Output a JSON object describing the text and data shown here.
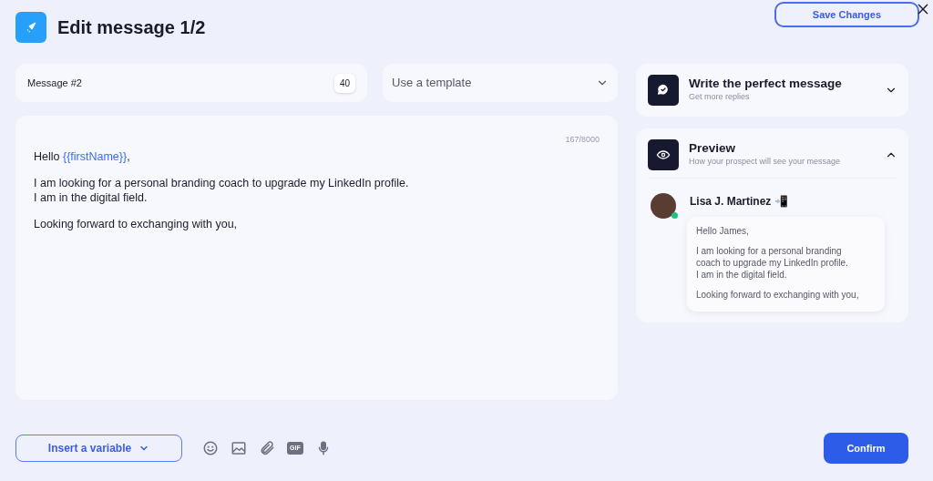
{
  "header": {
    "title": "Edit message 1/2",
    "save_button": "Save Changes"
  },
  "message_name": {
    "value": "Message #2",
    "count": "40"
  },
  "template_select": {
    "placeholder": "Use a template"
  },
  "editor": {
    "counter": "167/8000",
    "paragraphs": [
      [
        {
          "kind": "text",
          "text": "Hello "
        },
        {
          "kind": "variable",
          "text": "{{firstName}}"
        },
        {
          "kind": "text",
          "text": ","
        }
      ],
      [
        {
          "kind": "text",
          "text": "I am looking for a personal branding coach to upgrade my LinkedIn profile.\nI am in the digital field."
        }
      ],
      [
        {
          "kind": "text",
          "text": "Looking forward to exchanging with you,"
        }
      ]
    ]
  },
  "toolbar": {
    "variable_button": "Insert a variable",
    "tools": [
      {
        "kind": "emoji"
      },
      {
        "kind": "image"
      },
      {
        "kind": "attachment"
      },
      {
        "kind": "gif",
        "label": "GIF"
      },
      {
        "kind": "microphone"
      }
    ],
    "confirm_button": "Confirm"
  },
  "panels": [
    {
      "kind": "tips",
      "title": "Write the perfect message",
      "subtitle": "Get more replies",
      "expanded": false
    },
    {
      "kind": "preview",
      "title": "Preview",
      "subtitle": "How your prospect will see your message",
      "expanded": true,
      "sender": {
        "name": "Lisa J. Martinez",
        "emoji": "📲",
        "online": true
      },
      "paragraphs": [
        "Hello James,",
        "I am looking for a personal branding\ncoach to upgrade my LinkedIn profile.\nI am in the digital field.",
        "Looking forward to exchanging with you,"
      ]
    }
  ]
}
